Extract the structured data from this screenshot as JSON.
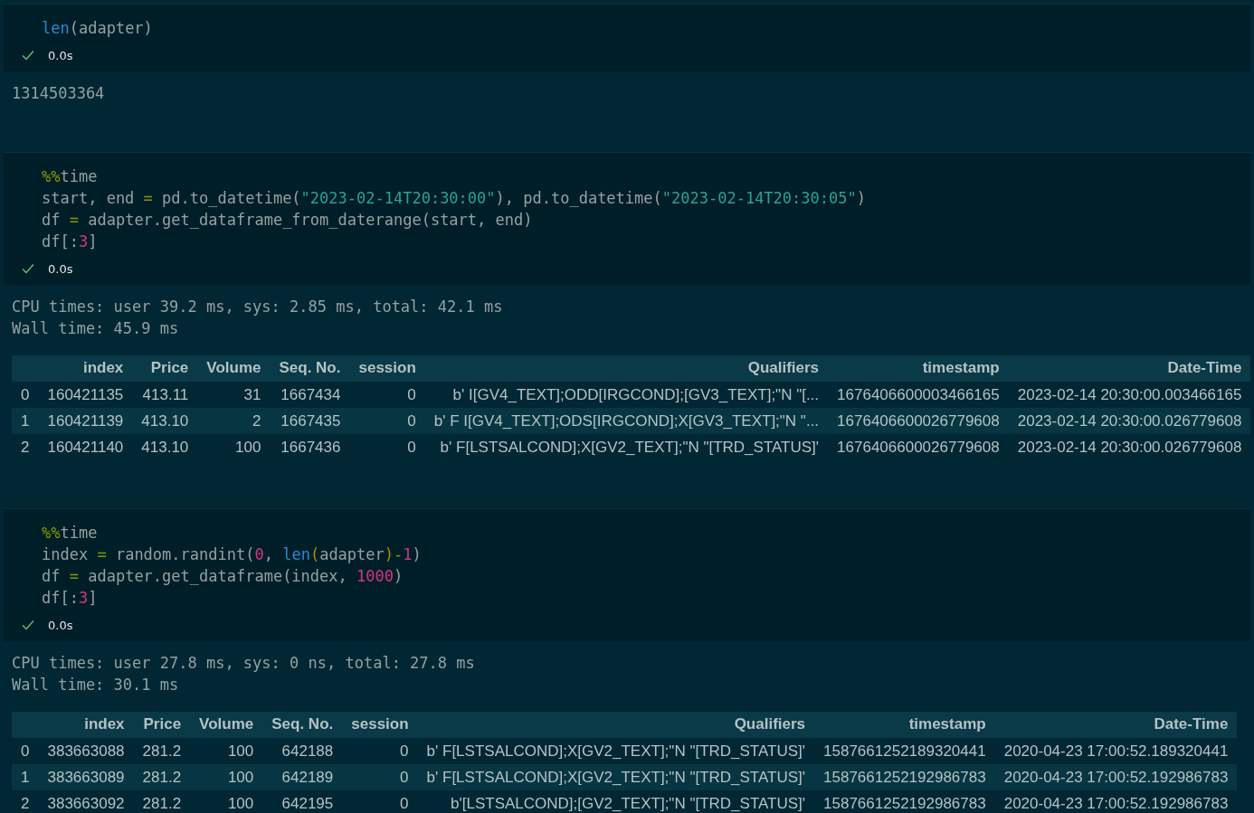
{
  "cells": [
    {
      "code": [
        [
          {
            "kind": "fn",
            "t": "len"
          },
          {
            "kind": "plain",
            "t": "(adapter)"
          }
        ]
      ],
      "status": {
        "ok": true,
        "duration": "0.0s"
      },
      "output": {
        "text": [
          "1314503364"
        ]
      }
    },
    {
      "code": [
        [
          {
            "kind": "magic",
            "t": "%%"
          },
          {
            "kind": "plain",
            "t": "time"
          }
        ],
        [
          {
            "kind": "plain",
            "t": "start, end "
          },
          {
            "kind": "op",
            "t": "="
          },
          {
            "kind": "plain",
            "t": " pd.to_datetime("
          },
          {
            "kind": "str",
            "t": "\"2023-02-14T20:30:00\""
          },
          {
            "kind": "plain",
            "t": "), pd.to_datetime("
          },
          {
            "kind": "str",
            "t": "\"2023-02-14T20:30:05\""
          },
          {
            "kind": "plain",
            "t": ")"
          }
        ],
        [
          {
            "kind": "plain",
            "t": "df "
          },
          {
            "kind": "op",
            "t": "="
          },
          {
            "kind": "plain",
            "t": " adapter.get_dataframe_from_daterange(start, end)"
          }
        ],
        [
          {
            "kind": "plain",
            "t": "df[:"
          },
          {
            "kind": "num",
            "t": "3"
          },
          {
            "kind": "plain",
            "t": "]"
          }
        ]
      ],
      "status": {
        "ok": true,
        "duration": "0.0s"
      },
      "output": {
        "text": [
          "CPU times: user 39.2 ms, sys: 2.85 ms, total: 42.1 ms",
          "Wall time: 45.9 ms"
        ],
        "table": {
          "columns": [
            "",
            "index",
            "Price",
            "Volume",
            "Seq. No.",
            "session",
            "Qualifiers",
            "timestamp",
            "Date-Time"
          ],
          "rows": [
            [
              "0",
              "160421135",
              "413.11",
              "31",
              "1667434",
              "0",
              "b' I[GV4_TEXT];ODD[IRGCOND];[GV3_TEXT];\"N \"[...",
              "1676406600003466165",
              "2023-02-14 20:30:00.003466165"
            ],
            [
              "1",
              "160421139",
              "413.10",
              "2",
              "1667435",
              "0",
              "b' F I[GV4_TEXT];ODS[IRGCOND];X[GV3_TEXT];\"N \"...",
              "1676406600026779608",
              "2023-02-14 20:30:00.026779608"
            ],
            [
              "2",
              "160421140",
              "413.10",
              "100",
              "1667436",
              "0",
              "b' F[LSTSALCOND];X[GV2_TEXT];\"N \"[TRD_STATUS]'",
              "1676406600026779608",
              "2023-02-14 20:30:00.026779608"
            ]
          ]
        }
      }
    },
    {
      "code": [
        [
          {
            "kind": "magic",
            "t": "%%"
          },
          {
            "kind": "plain",
            "t": "time"
          }
        ],
        [
          {
            "kind": "plain",
            "t": "index "
          },
          {
            "kind": "op",
            "t": "="
          },
          {
            "kind": "plain",
            "t": " random.randint("
          },
          {
            "kind": "num",
            "t": "0"
          },
          {
            "kind": "plain",
            "t": ", "
          },
          {
            "kind": "fn",
            "t": "len"
          },
          {
            "kind": "paren",
            "t": "("
          },
          {
            "kind": "plain",
            "t": "adapter"
          },
          {
            "kind": "paren",
            "t": ")"
          },
          {
            "kind": "op",
            "t": "-"
          },
          {
            "kind": "num",
            "t": "1"
          },
          {
            "kind": "plain",
            "t": ")"
          }
        ],
        [
          {
            "kind": "plain",
            "t": "df "
          },
          {
            "kind": "op",
            "t": "="
          },
          {
            "kind": "plain",
            "t": " adapter.get_dataframe(index, "
          },
          {
            "kind": "num",
            "t": "1000"
          },
          {
            "kind": "plain",
            "t": ")"
          }
        ],
        [
          {
            "kind": "plain",
            "t": "df[:"
          },
          {
            "kind": "num",
            "t": "3"
          },
          {
            "kind": "plain",
            "t": "]"
          }
        ]
      ],
      "status": {
        "ok": true,
        "duration": "0.0s"
      },
      "output": {
        "text": [
          "CPU times: user 27.8 ms, sys: 0 ns, total: 27.8 ms",
          "Wall time: 30.1 ms"
        ],
        "table": {
          "columns": [
            "",
            "index",
            "Price",
            "Volume",
            "Seq. No.",
            "session",
            "Qualifiers",
            "timestamp",
            "Date-Time"
          ],
          "rows": [
            [
              "0",
              "383663088",
              "281.2",
              "100",
              "642188",
              "0",
              "b' F[LSTSALCOND];X[GV2_TEXT];\"N \"[TRD_STATUS]'",
              "1587661252189320441",
              "2020-04-23 17:00:52.189320441"
            ],
            [
              "1",
              "383663089",
              "281.2",
              "100",
              "642189",
              "0",
              "b' F[LSTSALCOND];X[GV2_TEXT];\"N \"[TRD_STATUS]'",
              "1587661252192986783",
              "2020-04-23 17:00:52.192986783"
            ],
            [
              "2",
              "383663092",
              "281.2",
              "100",
              "642195",
              "0",
              "b'[LSTSALCOND];[GV2_TEXT];\"N \"[TRD_STATUS]'",
              "1587661252192986783",
              "2020-04-23 17:00:52.192986783"
            ]
          ]
        }
      }
    }
  ]
}
